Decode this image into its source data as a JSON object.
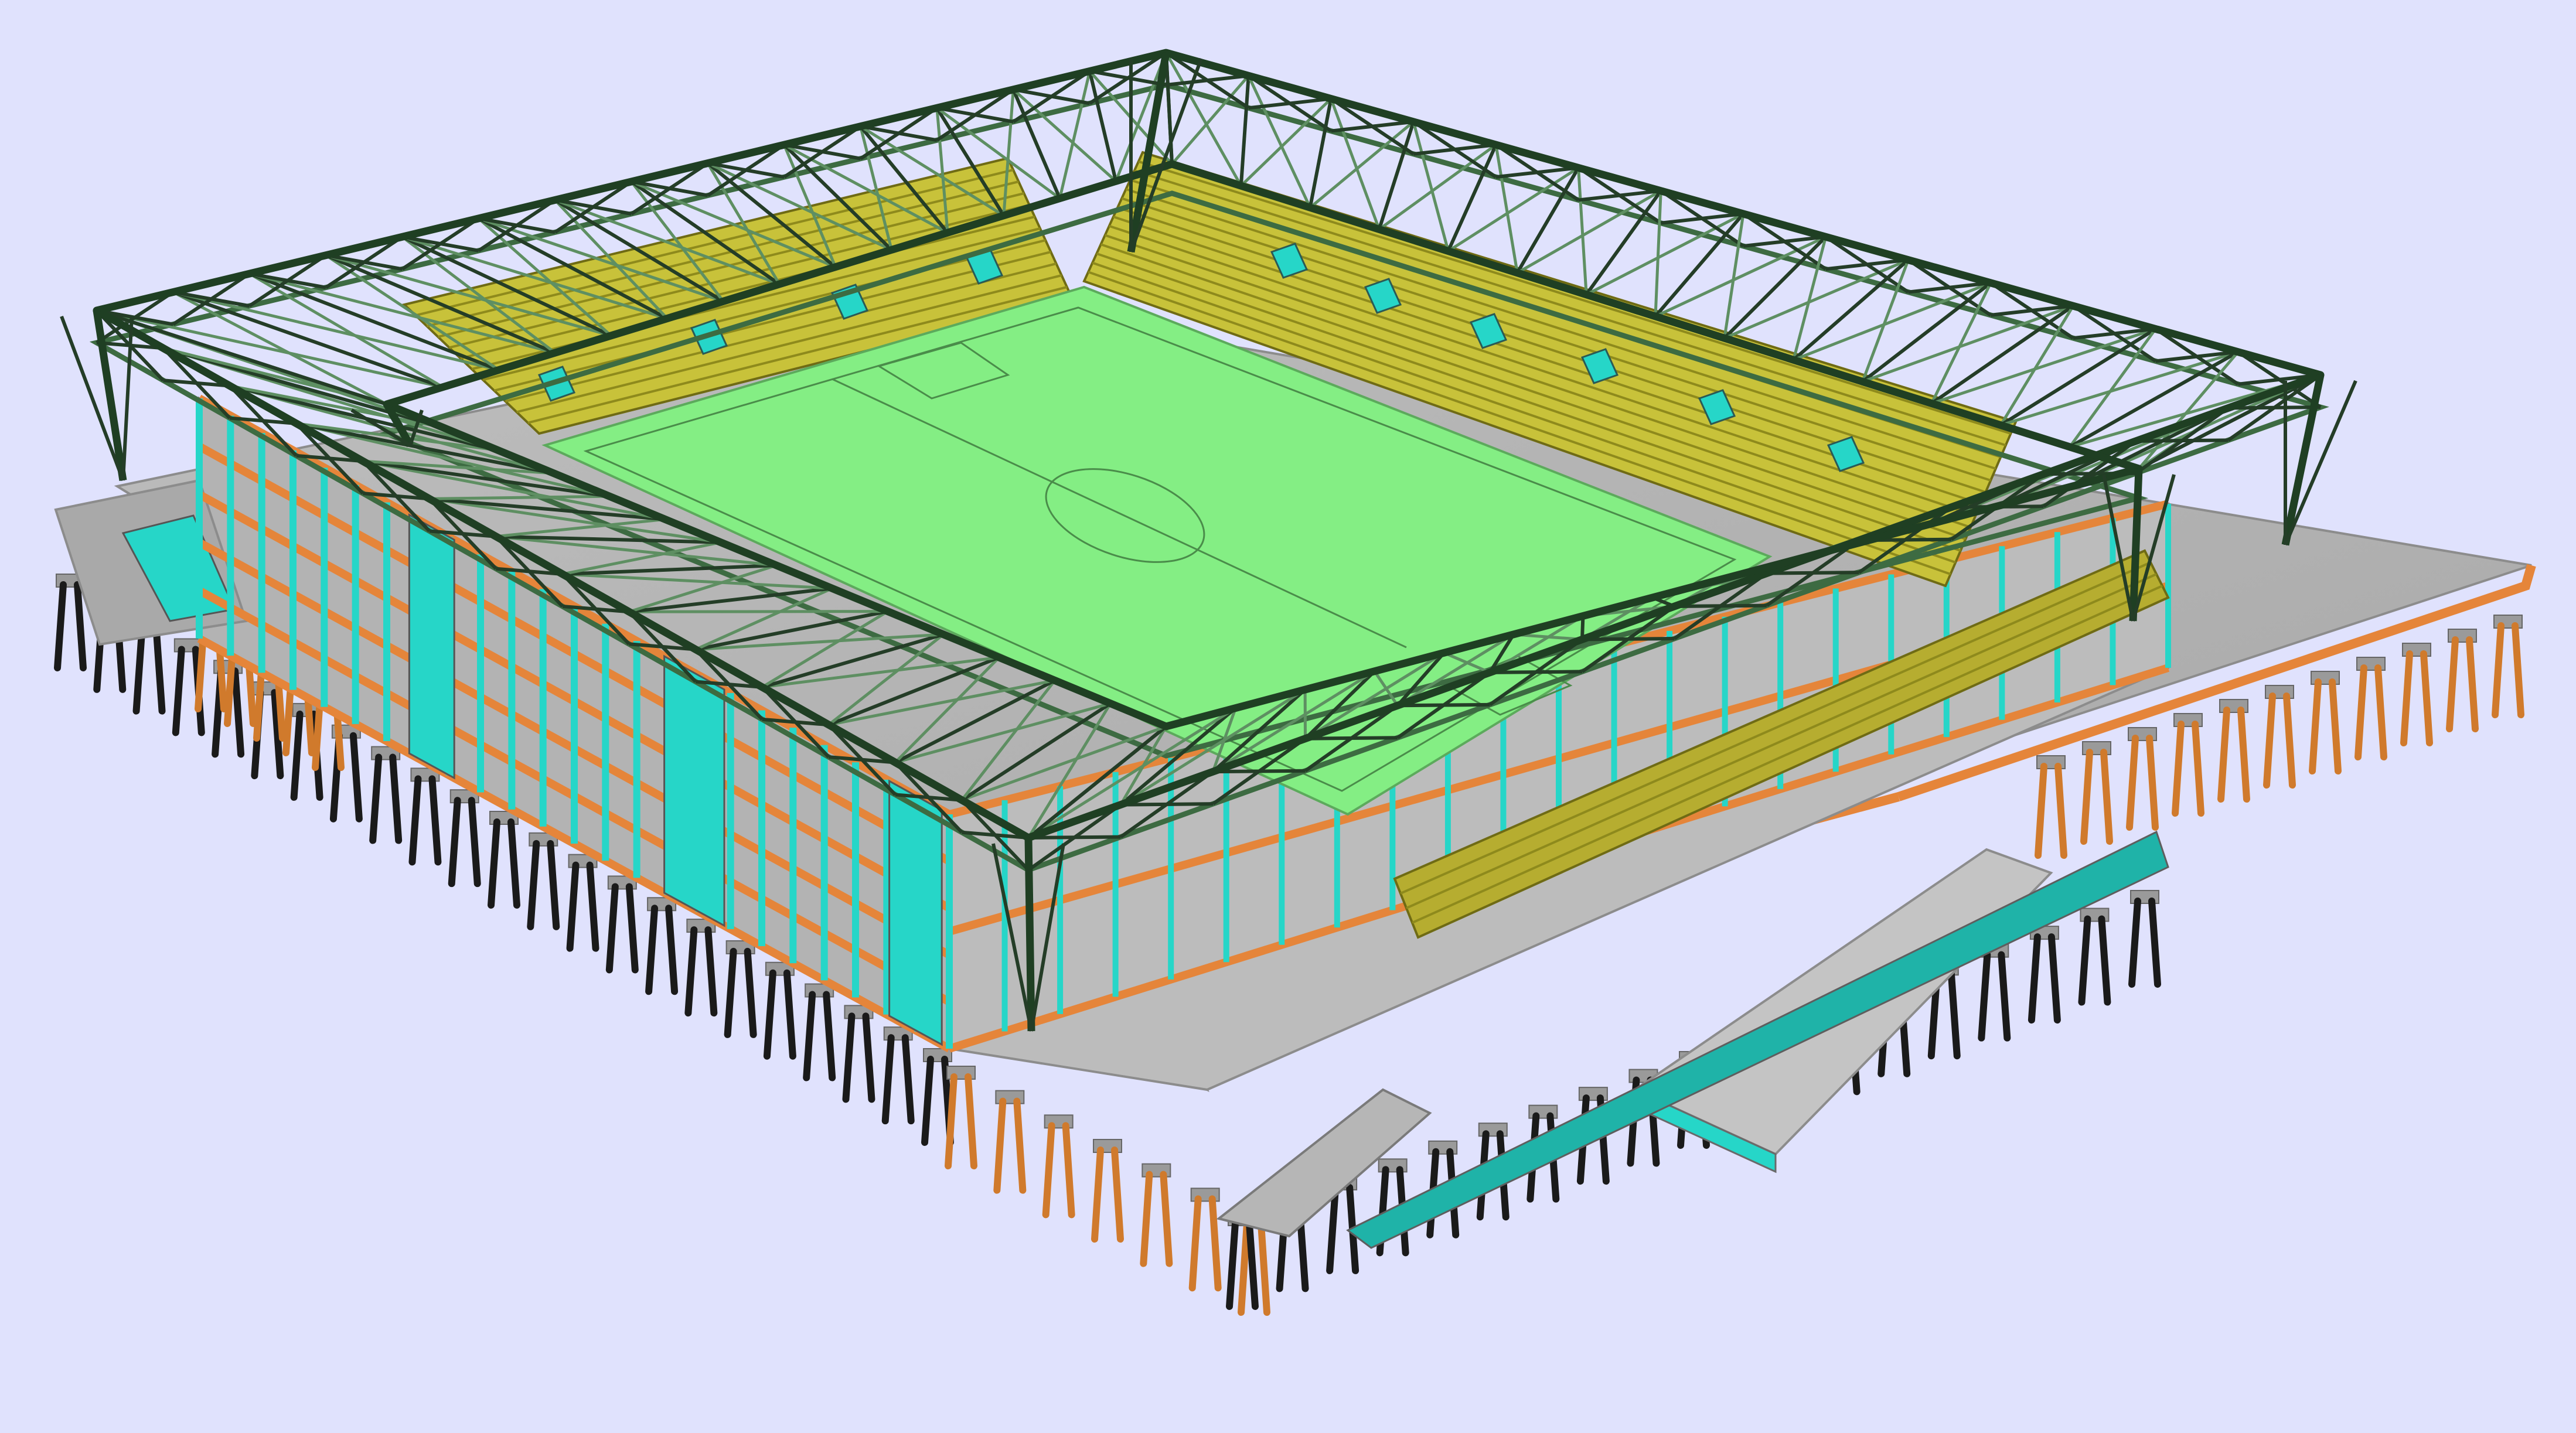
{
  "window": {
    "background": "#e0e2fd"
  },
  "colors": {
    "pitch": "#84ee84",
    "pitch_line": "#4a8c4a",
    "stand": "#c8c23a",
    "stand_dark": "#8e8a1c",
    "steel": "#1f3f23",
    "steel_light": "#5e8f62",
    "concrete": "#adadad",
    "concrete_light": "#c9c9c9",
    "concrete_dark": "#8c8c8c",
    "beam": "#e5853a",
    "column": "#26d6c8",
    "pile_dark": "#1a1a1a",
    "pile_orange": "#d07a2c",
    "pile_cap": "#9a9a9a"
  },
  "scene": {
    "parts": [
      {
        "name": "pitch",
        "color_key": "pitch"
      },
      {
        "name": "stands",
        "color_key": "stand"
      },
      {
        "name": "roof-truss",
        "color_key": "steel"
      },
      {
        "name": "concrete-structure",
        "color_key": "concrete"
      },
      {
        "name": "edge-beams",
        "color_key": "beam"
      },
      {
        "name": "columns",
        "color_key": "column"
      },
      {
        "name": "foundation-piles",
        "color_key": "pile_dark"
      }
    ]
  }
}
